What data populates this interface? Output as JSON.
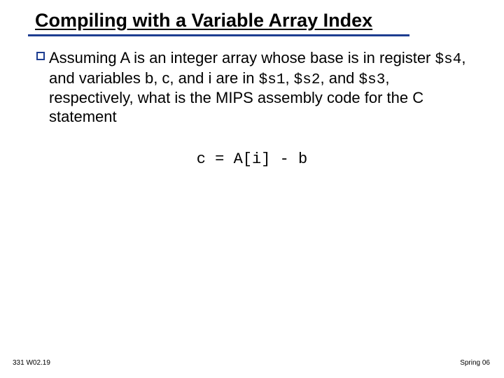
{
  "title": "Compiling with a Variable Array Index",
  "body": {
    "t1": "Assuming A is an integer array whose base is in register ",
    "r1": "$s4",
    "t2": ", and variables b, c, and i are in ",
    "r2": "$s1",
    "t3": ", ",
    "r3": "$s2",
    "t4": ", and ",
    "r4": "$s3",
    "t5": ", respectively, what is the MIPS assembly code for the C statement"
  },
  "code": "c = A[i] - b",
  "footer": {
    "left": "331 W02.19",
    "right": "Spring 06"
  }
}
